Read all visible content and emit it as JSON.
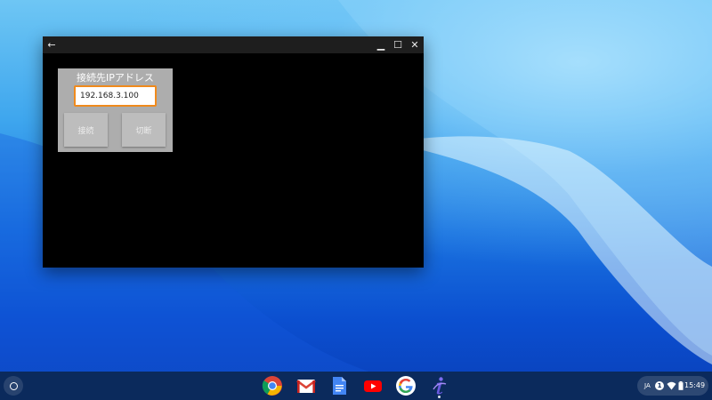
{
  "window": {
    "back_glyph": "←",
    "minimize_glyph": "▁",
    "maximize_glyph": "☐",
    "close_glyph": "✕"
  },
  "panel": {
    "label": "接続先IPアドレス",
    "ip_value": "192.168.3.100",
    "connect_label": "接続",
    "disconnect_label": "切断",
    "input_border_color": "#f08a1c"
  },
  "shelf": {
    "apps": [
      {
        "name": "chrome-icon"
      },
      {
        "name": "gmail-icon"
      },
      {
        "name": "docs-icon"
      },
      {
        "name": "youtube-icon"
      },
      {
        "name": "google-icon"
      },
      {
        "name": "custom-app-icon"
      }
    ],
    "status": {
      "ime": "JA",
      "notification_count": "1",
      "time": "15:49"
    }
  },
  "colors": {
    "shelf": "#0b2a5c",
    "wallpaper_accent": "#1a73e0"
  }
}
